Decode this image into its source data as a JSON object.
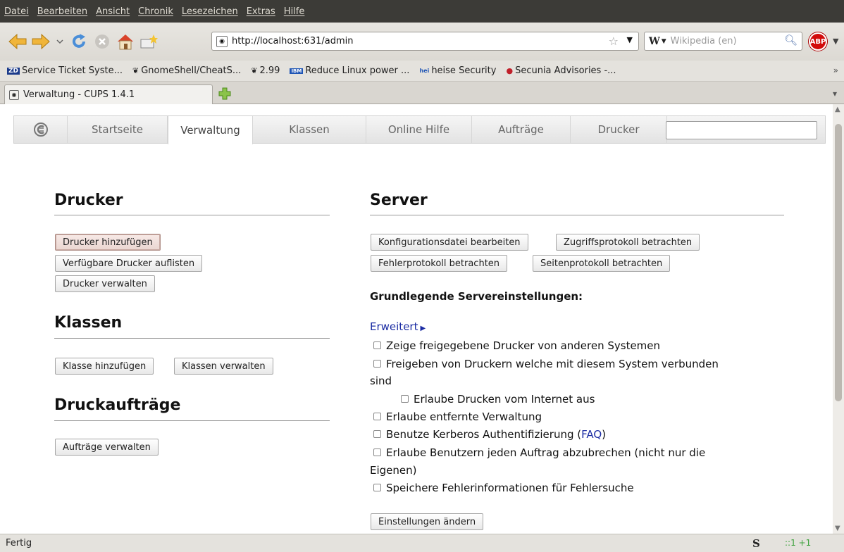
{
  "menubar": {
    "items": [
      "Datei",
      "Bearbeiten",
      "Ansicht",
      "Chronik",
      "Lesezeichen",
      "Extras",
      "Hilfe"
    ]
  },
  "navbar": {
    "url": "http://localhost:631/admin",
    "search_engine_glyph": "W",
    "search_placeholder": "Wikipedia (en)",
    "abp_label": "ABP",
    "icons": [
      "back-arrow-icon",
      "forward-arrow-icon",
      "history-dropdown-icon",
      "reload-icon",
      "stop-icon",
      "home-icon",
      "bookmark-star-icon",
      "site-identity-icon",
      "star-icon",
      "search-icon",
      "adblock-icon"
    ]
  },
  "bookmarks": {
    "items": [
      {
        "icon": "ZD",
        "label": "Service Ticket Syste..."
      },
      {
        "icon": "❦",
        "label": "GnomeShell/CheatS..."
      },
      {
        "icon": "❦",
        "label": "2.99"
      },
      {
        "icon": "IBM",
        "label": "Reduce Linux power ..."
      },
      {
        "icon": "hei",
        "label": "heise Security"
      },
      {
        "icon": "●",
        "label": "Secunia Advisories -..."
      }
    ],
    "more": "»"
  },
  "tabs": {
    "active_title": "Verwaltung - CUPS 1.4.1"
  },
  "cups_nav": {
    "items": [
      "Startseite",
      "Verwaltung",
      "Klassen",
      "Online Hilfe",
      "Aufträge",
      "Drucker"
    ],
    "active": "Verwaltung"
  },
  "left": {
    "printers_title": "Drucker",
    "printers_buttons": [
      "Drucker hinzufügen",
      "Verfügbare Drucker auflisten",
      "Drucker verwalten"
    ],
    "classes_title": "Klassen",
    "classes_buttons": [
      "Klasse hinzufügen",
      "Klassen verwalten"
    ],
    "jobs_title": "Druckaufträge",
    "jobs_buttons": [
      "Aufträge verwalten"
    ]
  },
  "server": {
    "title": "Server",
    "buttons": [
      "Konfigurationsdatei bearbeiten",
      "Zugriffsprotokoll betrachten",
      "Fehlerprotokoll betrachten",
      "Seitenprotokoll betrachten"
    ],
    "settings_title": "Grundlegende Servereinstellungen:",
    "advanced_link": "Erweitert",
    "options": {
      "share_remote": "Zeige freigegebene Drucker von anderen Systemen",
      "share_local_1": "Freigeben von Druckern welche mit diesem System verbunden",
      "share_local_2": "sind",
      "internet": "Erlaube Drucken vom Internet aus",
      "remote_admin": "Erlaube entfernte Verwaltung",
      "kerberos_prefix": "Benutze Kerberos Authentifizierung (",
      "kerberos_link": "FAQ",
      "kerberos_suffix": ")",
      "cancel_1": "Erlaube Benutzern jeden Auftrag abzubrechen (nicht nur die",
      "cancel_2": "Eigenen)",
      "debug": "Speichere Fehlerinformationen für Fehlersuche"
    },
    "apply_button": "Einstellungen ändern"
  },
  "statusbar": {
    "text": "Fertig",
    "s_icon": "S",
    "ip_indicator": "::1 +1"
  },
  "colors": {
    "link": "#1b2ca3",
    "menubar_bg": "#3c3b37",
    "focused_button_bg": "#f7e9e6"
  }
}
